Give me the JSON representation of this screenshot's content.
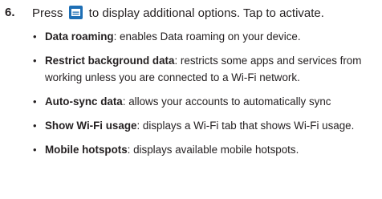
{
  "step": {
    "number": "6.",
    "text_before_icon": "Press",
    "icon": "menu-key-icon",
    "icon_color": "#1e6fb5",
    "text_after_icon": "to display additional options. Tap to activate."
  },
  "options": [
    {
      "term": "Data roaming",
      "separator": ": ",
      "description": "enables Data roaming on your device."
    },
    {
      "term": "Restrict background data",
      "separator": ": ",
      "description": "restricts some apps and services from working unless you are connected to a Wi-Fi network."
    },
    {
      "term": "Auto-sync data",
      "separator": ": ",
      "description": "allows your accounts to automatically sync"
    },
    {
      "term": "Show Wi-Fi usage",
      "separator": ": ",
      "description": "displays a Wi-Fi tab that shows Wi-Fi usage."
    },
    {
      "term": "Mobile hotspots",
      "separator": ": ",
      "description": "displays available mobile hotspots."
    }
  ]
}
